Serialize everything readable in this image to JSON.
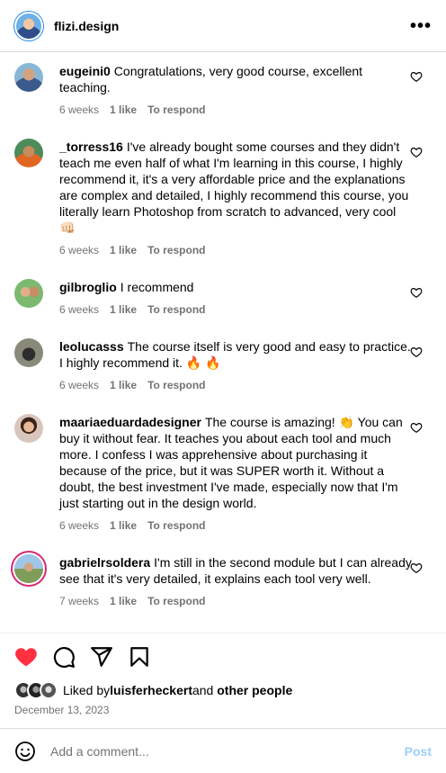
{
  "header": {
    "username": "flizi.design",
    "more_label": "•••"
  },
  "comments": [
    {
      "user": "eugeini0",
      "text": "Congratulations, very good course, excellent teaching.",
      "time": "6 weeks",
      "likes": "1 like",
      "reply": "To respond",
      "emoji": ""
    },
    {
      "user": "_torress16",
      "text": "I've already bought some courses and they didn't teach me even half of what I'm learning in this course, I highly recommend it, it's a very affordable price and the explanations are complex and detailed, I highly recommend this course, you literally learn Photoshop from scratch to advanced, very cool",
      "time": "6 weeks",
      "likes": "1 like",
      "reply": "To respond",
      "emoji": "👊🏻"
    },
    {
      "user": "gilbroglio",
      "text": "I recommend",
      "time": "6 weeks",
      "likes": "1 like",
      "reply": "To respond",
      "emoji": ""
    },
    {
      "user": "leolucasss",
      "text": "The course itself is very good and easy to practice. I highly recommend it.",
      "time": "6 weeks",
      "likes": "1 like",
      "reply": "To respond",
      "emoji": "🔥 🔥"
    },
    {
      "user": "maariaeduardadesigner",
      "text": "The course is amazing! 👏 You can buy it without fear. It teaches you about each tool and much more. I confess I was apprehensive about purchasing it because of the price, but it was SUPER worth it. Without a doubt, the best investment I've made, especially now that I'm just starting out in the design world.",
      "time": "6 weeks",
      "likes": "1 like",
      "reply": "To respond",
      "emoji": ""
    },
    {
      "user": "gabrielrsoldera",
      "text": "I'm still in the second module but I can already see that it's very detailed, it explains each tool very well.",
      "time": "7 weeks",
      "likes": "1 like",
      "reply": "To respond",
      "emoji": ""
    }
  ],
  "likes": {
    "prefix": "Liked by",
    "user": "luisferheckert",
    "suffix": "and",
    "others": "other people"
  },
  "post_date": "December 13, 2023",
  "add_comment": {
    "placeholder": "Add a comment...",
    "post_label": "Post"
  },
  "colors": {
    "heart_red": "#ff3040",
    "post_button": "#9ccffa",
    "meta_gray": "#737373"
  }
}
